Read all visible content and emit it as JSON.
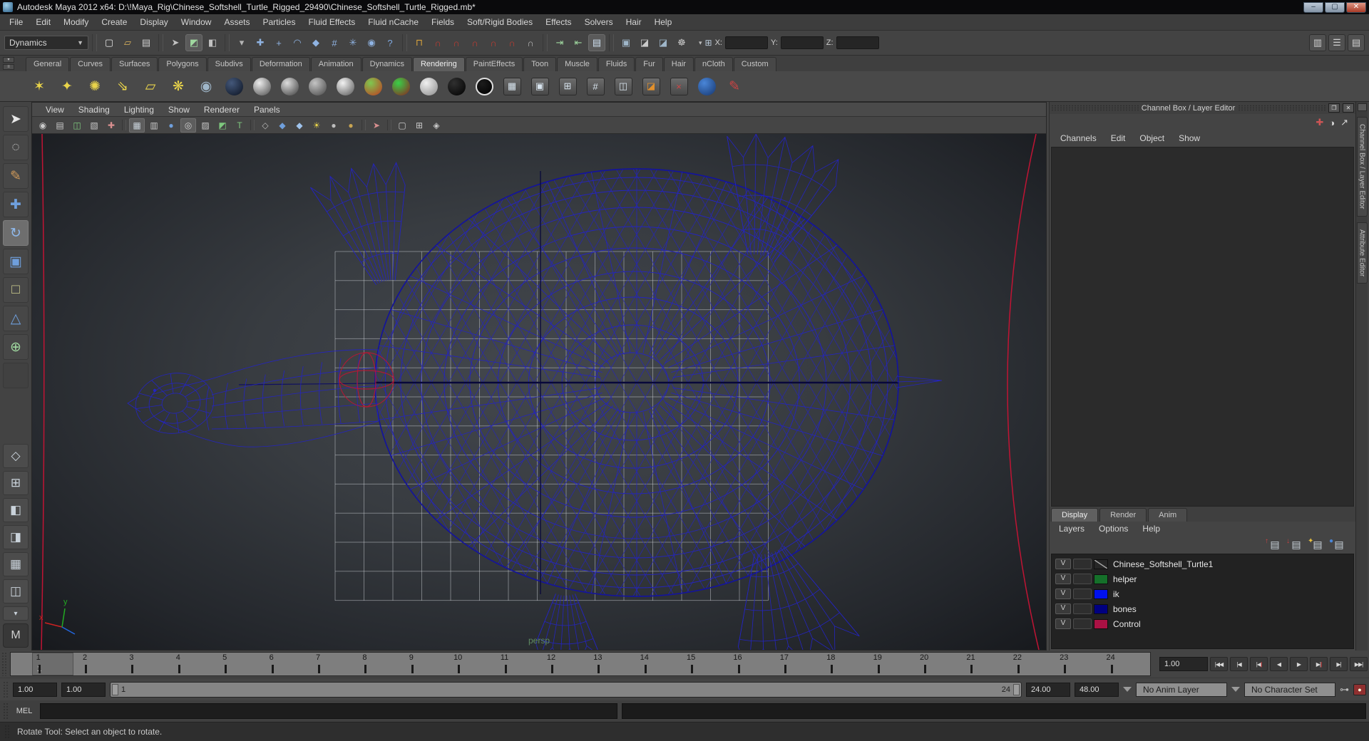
{
  "window": {
    "title": "Autodesk Maya 2012 x64: D:\\!Maya_Rig\\Chinese_Softshell_Turtle_Rigged_29490\\Chinese_Softshell_Turtle_Rigged.mb*",
    "minimize": "–",
    "maximize": "▢",
    "close": "✕"
  },
  "menubar": {
    "items": [
      "File",
      "Edit",
      "Modify",
      "Create",
      "Display",
      "Window",
      "Assets",
      "Particles",
      "Fluid Effects",
      "Fluid nCache",
      "Fields",
      "Soft/Rigid Bodies",
      "Effects",
      "Solvers",
      "Hair",
      "Help"
    ]
  },
  "statusline": {
    "menuset": "Dynamics",
    "groups": [
      [
        {
          "name": "new-scene-button",
          "glyph": "▢",
          "color": "#e2e2e2"
        },
        {
          "name": "open-scene-button",
          "glyph": "▱",
          "color": "#d9b35c"
        },
        {
          "name": "save-scene-button",
          "glyph": "▤",
          "color": "#cfcfcf"
        }
      ],
      [
        {
          "name": "select-by-hierarchy-button",
          "glyph": "➤",
          "color": "#c2c2c2"
        },
        {
          "name": "select-by-object-button",
          "glyph": "◩",
          "color": "#9fd89f",
          "active": true
        },
        {
          "name": "select-by-component-button",
          "glyph": "◧",
          "color": "#c2c2c2"
        }
      ],
      [
        {
          "name": "selection-mask-dropdown",
          "glyph": "▾",
          "color": "#b5b5b5"
        },
        {
          "name": "select-handles-mask-button",
          "glyph": "✚",
          "color": "#8fb3e2"
        },
        {
          "name": "select-joints-mask-button",
          "glyph": "+",
          "color": "#8fb3e2"
        },
        {
          "name": "select-curves-mask-button",
          "glyph": "◠",
          "color": "#8fb3e2"
        },
        {
          "name": "select-surfaces-mask-button",
          "glyph": "◆",
          "color": "#8fb3e2"
        },
        {
          "name": "select-deformations-mask-button",
          "glyph": "#",
          "color": "#8fb3e2"
        },
        {
          "name": "select-dynamics-mask-button",
          "glyph": "✳",
          "color": "#8fb3e2"
        },
        {
          "name": "select-rendering-mask-button",
          "glyph": "◉",
          "color": "#8fb3e2"
        },
        {
          "name": "select-misc-mask-button",
          "glyph": "?",
          "color": "#7fa8e0"
        }
      ],
      [
        {
          "name": "lock-selection-button",
          "glyph": "⊓",
          "color": "#d9a33c"
        },
        {
          "name": "snap-to-grids-button",
          "glyph": "∩",
          "color": "#c23b30"
        },
        {
          "name": "snap-to-curves-button",
          "glyph": "∩",
          "color": "#c23b30"
        },
        {
          "name": "snap-to-points-button",
          "glyph": "∩",
          "color": "#c23b30"
        },
        {
          "name": "snap-to-projected-center-button",
          "glyph": "∩",
          "color": "#c23b30"
        },
        {
          "name": "snap-to-view-planes-button",
          "glyph": "∩",
          "color": "#c23b30"
        },
        {
          "name": "make-live-button",
          "glyph": "∩",
          "color": "#b8b8b8"
        }
      ],
      [
        {
          "name": "input-connections-button",
          "glyph": "⇥",
          "color": "#9fd89f"
        },
        {
          "name": "output-connections-button",
          "glyph": "⇤",
          "color": "#9fd89f"
        },
        {
          "name": "construction-history-toggle",
          "glyph": "▤",
          "color": "#cfe0f0",
          "active": true
        }
      ],
      [
        {
          "name": "open-render-view-button",
          "glyph": "▣",
          "color": "#9fb6c9"
        },
        {
          "name": "render-current-frame-button",
          "glyph": "◪",
          "color": "#c9c9c9"
        },
        {
          "name": "ipr-render-button",
          "glyph": "◪",
          "color": "#9fb6c9"
        },
        {
          "name": "render-settings-button",
          "glyph": "☸",
          "color": "#c9c9c9"
        }
      ]
    ],
    "coord_dropdown": "▾",
    "coord_icon": "⊞",
    "x_label": "X:",
    "y_label": "Y:",
    "z_label": "Z:",
    "right_toggles": [
      {
        "name": "channel-box-toggle",
        "glyph": "▥"
      },
      {
        "name": "tool-settings-toggle",
        "glyph": "☰"
      },
      {
        "name": "attribute-editor-toggle",
        "glyph": "▤"
      }
    ]
  },
  "shelf": {
    "active": "Rendering",
    "tabs": [
      "General",
      "Curves",
      "Surfaces",
      "Polygons",
      "Subdivs",
      "Deformation",
      "Animation",
      "Dynamics",
      "Rendering",
      "PaintEffects",
      "Toon",
      "Muscle",
      "Fluids",
      "Fur",
      "Hair",
      "nCloth",
      "Custom"
    ],
    "icons": [
      {
        "name": "ambient-light-icon",
        "kind": "glyph",
        "glyph": "✶",
        "color": "#e9d44a"
      },
      {
        "name": "spot-light-icon",
        "kind": "glyph",
        "glyph": "✦",
        "color": "#e9d44a"
      },
      {
        "name": "point-light-icon",
        "kind": "glyph",
        "glyph": "✺",
        "color": "#e9d44a"
      },
      {
        "name": "directional-light-icon",
        "kind": "glyph",
        "glyph": "⇘",
        "color": "#e9d44a"
      },
      {
        "name": "area-light-icon",
        "kind": "glyph",
        "glyph": "▱",
        "color": "#e9d44a"
      },
      {
        "name": "volume-light-icon",
        "kind": "glyph",
        "glyph": "❋",
        "color": "#e9d44a"
      },
      {
        "name": "camera-icon",
        "kind": "glyph",
        "glyph": "◉",
        "color": "#9fb6c9"
      },
      {
        "name": "ocean-shader-icon",
        "kind": "sphere",
        "c1": "#44587a",
        "c2": "#0b1220"
      },
      {
        "name": "anisotropic-material-icon",
        "kind": "sphere",
        "c1": "#ececec",
        "c2": "#4c4c4c"
      },
      {
        "name": "blinn-material-icon",
        "kind": "sphere",
        "c1": "#dcdcdc",
        "c2": "#3c3c3c"
      },
      {
        "name": "lambert-material-icon",
        "kind": "sphere",
        "c1": "#c4c4c4",
        "c2": "#454545"
      },
      {
        "name": "phong-material-icon",
        "kind": "sphere",
        "c1": "#f2f2f2",
        "c2": "#565656"
      },
      {
        "name": "ramp-shader-icon",
        "kind": "sphere",
        "c1": "#7ec850",
        "c2": "#c03a20"
      },
      {
        "name": "shading-map-icon",
        "kind": "sphere",
        "c1": "#38d048",
        "c2": "#8e2020"
      },
      {
        "name": "surface-shader-icon",
        "kind": "sphere",
        "c1": "#f0f0f0",
        "c2": "#8a8a8a"
      },
      {
        "name": "displacement-shader-icon",
        "kind": "sphere",
        "c1": "#303030",
        "c2": "#000000"
      },
      {
        "name": "use-background-icon",
        "kind": "sphere",
        "c1": "#1c1c1c",
        "c2": "#000000",
        "ring": true
      },
      {
        "name": "hypershade-icon",
        "kind": "panel",
        "glyph": "▦"
      },
      {
        "name": "render-view-icon",
        "kind": "panel",
        "glyph": "▣"
      },
      {
        "name": "render-settings-window-icon",
        "kind": "panel",
        "glyph": "⊞"
      },
      {
        "name": "hypergraph-icon",
        "kind": "panel",
        "glyph": "#"
      },
      {
        "name": "light-linker-icon",
        "kind": "panel",
        "glyph": "◫"
      },
      {
        "name": "render-flag-icon",
        "kind": "panel",
        "glyph": "◪",
        "color": "#e2902c"
      },
      {
        "name": "ipr-stop-icon",
        "kind": "panel",
        "glyph": "×",
        "color": "#d04545"
      },
      {
        "name": "render-globe-icon",
        "kind": "sphere",
        "c1": "#4a86d8",
        "c2": "#15366e"
      },
      {
        "name": "paint-effects-brush-icon",
        "kind": "glyph",
        "glyph": "✎",
        "color": "#cc4444"
      }
    ]
  },
  "toolbox": {
    "tools": [
      {
        "name": "select-tool",
        "glyph": "➤",
        "color": "#e8e8e8"
      },
      {
        "name": "lasso-tool",
        "glyph": "◌",
        "color": "#d8d8d8"
      },
      {
        "name": "paint-selection-tool",
        "glyph": "✎",
        "color": "#cf9a5a"
      },
      {
        "name": "move-tool",
        "glyph": "✚",
        "color": "#6f9fdc"
      },
      {
        "name": "rotate-tool",
        "glyph": "↻",
        "color": "#8fb9ec",
        "active": true
      },
      {
        "name": "scale-tool",
        "glyph": "▣",
        "color": "#6f9fdc"
      },
      {
        "name": "universal-manipulator-tool",
        "glyph": "□",
        "color": "#cfcf8f"
      },
      {
        "name": "soft-modification-tool",
        "glyph": "△",
        "color": "#6f9fdc"
      },
      {
        "name": "last-tool-used",
        "glyph": "⊕",
        "color": "#9fd89f"
      }
    ],
    "layouts": [
      {
        "name": "layout-single-pane-button",
        "glyph": "◇"
      },
      {
        "name": "layout-four-pane-button",
        "glyph": "⊞"
      },
      {
        "name": "layout-outliner-persp-button",
        "glyph": "◧"
      },
      {
        "name": "layout-persp-graph-button",
        "glyph": "◨"
      },
      {
        "name": "layout-hypershade-persp-button",
        "glyph": "▦"
      },
      {
        "name": "layout-persp-trax-button",
        "glyph": "◫"
      }
    ],
    "layout_dropdown": "▾",
    "logo": "M"
  },
  "viewport": {
    "menus": [
      "View",
      "Shading",
      "Lighting",
      "Show",
      "Renderer",
      "Panels"
    ],
    "icons": [
      {
        "name": "camera-select-icon",
        "glyph": "◉",
        "color": "#c9c9c9"
      },
      {
        "name": "camera-attributes-icon",
        "glyph": "▤",
        "color": "#c9c9c9"
      },
      {
        "name": "bookmark-icon",
        "glyph": "◫",
        "color": "#7ec87e"
      },
      {
        "name": "image-plane-icon",
        "glyph": "▧",
        "color": "#c9c9c9"
      },
      {
        "name": "2d-pan-zoom-icon",
        "glyph": "✚",
        "color": "#d88f8f"
      },
      {
        "name": "sep"
      },
      {
        "name": "grid-toggle-icon",
        "glyph": "▦",
        "color": "#c9d2da",
        "active": true
      },
      {
        "name": "film-gate-icon",
        "glyph": "▥",
        "color": "#c9c9c9"
      },
      {
        "name": "resolution-gate-icon",
        "glyph": "●",
        "color": "#6f9fdc"
      },
      {
        "name": "gate-mask-icon",
        "glyph": "◎",
        "color": "#d0d0d0",
        "active": true
      },
      {
        "name": "field-chart-icon",
        "glyph": "▨",
        "color": "#c9c9c9"
      },
      {
        "name": "safe-action-icon",
        "glyph": "◩",
        "color": "#7ec87e"
      },
      {
        "name": "safe-title-icon",
        "glyph": "T",
        "color": "#7ec87e"
      },
      {
        "name": "sep"
      },
      {
        "name": "wireframe-icon",
        "glyph": "◇",
        "color": "#b9b9b9"
      },
      {
        "name": "smooth-shade-icon",
        "glyph": "◆",
        "color": "#6f9fdc"
      },
      {
        "name": "textured-icon",
        "glyph": "◆",
        "color": "#9fc3ec"
      },
      {
        "name": "use-all-lights-icon",
        "glyph": "☀",
        "color": "#e9d44a"
      },
      {
        "name": "shadows-icon",
        "glyph": "●",
        "color": "#bdbdbd"
      },
      {
        "name": "default-material-icon",
        "glyph": "●",
        "color": "#c8a452"
      },
      {
        "name": "sep"
      },
      {
        "name": "isolate-select-icon",
        "glyph": "➤",
        "color": "#d88f8f"
      },
      {
        "name": "sep"
      },
      {
        "name": "xray-icon",
        "glyph": "▢",
        "color": "#c9c9c9"
      },
      {
        "name": "xray-joints-icon",
        "glyph": "⊞",
        "color": "#c9c9c9"
      },
      {
        "name": "wireframe-on-shaded-icon",
        "glyph": "◈",
        "color": "#c9c9c9"
      }
    ],
    "camera": "persp",
    "axis_x": "x",
    "axis_y": "y"
  },
  "channel_box": {
    "title": "Channel Box / Layer Editor",
    "float_glyph": "❐",
    "close_glyph": "✕",
    "menus": [
      "Channels",
      "Edit",
      "Object",
      "Show"
    ],
    "mini_icons": [
      {
        "name": "manipulator-axis-icon",
        "glyph": "✚",
        "color": "#cc5555"
      },
      {
        "name": "speed-dial-icon",
        "glyph": "◑",
        "color": "#d8d8d8"
      },
      {
        "name": "slider-mode-icon",
        "glyph": "↗",
        "color": "#d8d8d8"
      }
    ]
  },
  "layer_editor": {
    "tabs": [
      "Display",
      "Render",
      "Anim"
    ],
    "active": "Display",
    "menus": [
      "Layers",
      "Options",
      "Help"
    ],
    "icons": [
      {
        "name": "move-layer-up-icon",
        "base": "▤",
        "overlay": "↑",
        "ocolor": "#d04040"
      },
      {
        "name": "move-layer-down-icon",
        "base": "▤",
        "overlay": "↓",
        "ocolor": "#d04040"
      },
      {
        "name": "create-empty-layer-icon",
        "base": "▤",
        "overlay": "✦",
        "ocolor": "#e8c040"
      },
      {
        "name": "create-layer-from-selected-icon",
        "base": "▤",
        "overlay": "●",
        "ocolor": "#4a86d8"
      }
    ],
    "layers": [
      {
        "vis": "V",
        "swatch": "ref",
        "name": "Chinese_Softshell_Turtle1"
      },
      {
        "vis": "V",
        "swatch": "#15702a",
        "name": "helper"
      },
      {
        "vis": "V",
        "swatch": "#0011ee",
        "name": "ik"
      },
      {
        "vis": "V",
        "swatch": "#000080",
        "name": "bones"
      },
      {
        "vis": "V",
        "swatch": "#aa1144",
        "name": "Control"
      }
    ]
  },
  "side_tabs": [
    "Channel Box / Layer Editor",
    "Attribute Editor"
  ],
  "time_slider": {
    "frames": [
      "1",
      "2",
      "3",
      "4",
      "5",
      "6",
      "7",
      "8",
      "9",
      "10",
      "11",
      "12",
      "13",
      "14",
      "15",
      "16",
      "17",
      "18",
      "19",
      "20",
      "21",
      "22",
      "23",
      "24"
    ],
    "current_frame": "1",
    "current_time": "1.00",
    "playback": [
      {
        "name": "go-to-start-button",
        "glyph": "|◀◀"
      },
      {
        "name": "step-back-frame-button",
        "glyph": "|◀"
      },
      {
        "name": "step-back-key-button",
        "glyph": "|◀",
        "key": true
      },
      {
        "name": "play-backwards-button",
        "glyph": "◀"
      },
      {
        "name": "play-forwards-button",
        "glyph": "▶"
      },
      {
        "name": "step-forward-key-button",
        "glyph": "▶|",
        "key": true
      },
      {
        "name": "step-forward-frame-button",
        "glyph": "▶|"
      },
      {
        "name": "go-to-end-button",
        "glyph": "▶▶|"
      }
    ]
  },
  "range_slider": {
    "anim_start": "1.00",
    "play_start": "1.00",
    "bar_start": "1",
    "bar_end": "24",
    "play_end": "24.00",
    "anim_end": "48.00",
    "anim_layer": "No Anim Layer",
    "character_set": "No Character Set",
    "key_glyph": "⊶"
  },
  "command_line": {
    "label": "MEL",
    "value": ""
  },
  "help_line": {
    "text": "Rotate Tool: Select an object to rotate."
  },
  "colors": {
    "wireframe": "#2424c0",
    "wire_dark": "#08083a",
    "wire_outline": "#14149a",
    "grid": "#d2d7dc",
    "curve_red": "#c01434",
    "persp_label": "#5f8a63"
  }
}
